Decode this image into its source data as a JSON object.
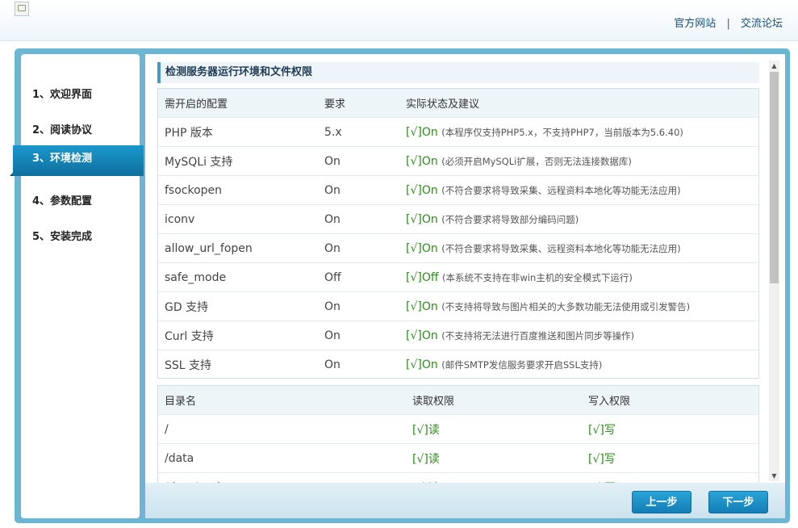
{
  "header": {
    "links": [
      "官方网站",
      "交流论坛"
    ],
    "separator": "|"
  },
  "sidebar": {
    "steps": [
      "1、欢迎界面",
      "2、阅读协议",
      "3、环境检测",
      "4、参数配置",
      "5、安装完成"
    ],
    "active_index": 2
  },
  "env": {
    "title": "检测服务器运行环境和文件权限",
    "headers": [
      "需开启的配置",
      "要求",
      "实际状态及建议"
    ],
    "rows": [
      {
        "name": "PHP 版本",
        "req": "5.x",
        "status": "[√]On",
        "note": "(本程序仅支持PHP5.x，不支持PHP7，当前版本为5.6.40)"
      },
      {
        "name": "MySQLi 支持",
        "req": "On",
        "status": "[√]On",
        "note": "(必须开启MySQLi扩展，否则无法连接数据库)"
      },
      {
        "name": "fsockopen",
        "req": "On",
        "status": "[√]On",
        "note": "(不符合要求将导致采集、远程资料本地化等功能无法应用)"
      },
      {
        "name": "iconv",
        "req": "On",
        "status": "[√]On",
        "note": "(不符合要求将导致部分编码问题)"
      },
      {
        "name": "allow_url_fopen",
        "req": "On",
        "status": "[√]On",
        "note": "(不符合要求将导致采集、远程资料本地化等功能无法应用)"
      },
      {
        "name": "safe_mode",
        "req": "Off",
        "status": "[√]Off",
        "note": "(本系统不支持在非win主机的安全模式下运行)"
      },
      {
        "name": "GD 支持",
        "req": "On",
        "status": "[√]On",
        "note": "(不支持将导致与图片相关的大多数功能无法使用或引发警告)"
      },
      {
        "name": "Curl 支持",
        "req": "On",
        "status": "[√]On",
        "note": "(不支持将无法进行百度推送和图片同步等操作)"
      },
      {
        "name": "SSL 支持",
        "req": "On",
        "status": "[√]On",
        "note": "(邮件SMTP发信服务要求开启SSL支持)"
      }
    ]
  },
  "dirs": {
    "headers": [
      "目录名",
      "读取权限",
      "写入权限"
    ],
    "rows": [
      {
        "name": "/",
        "read": "[√]读",
        "write": "[√]写"
      },
      {
        "name": "/data",
        "read": "[√]读",
        "write": "[√]写"
      },
      {
        "name": "/data/cache",
        "read": "[√]读",
        "write": "[√]写"
      }
    ]
  },
  "footer": {
    "prev_label": "上一步",
    "next_label": "下一步"
  },
  "scroll": {
    "up_glyph": "▲",
    "down_glyph": "▼"
  }
}
